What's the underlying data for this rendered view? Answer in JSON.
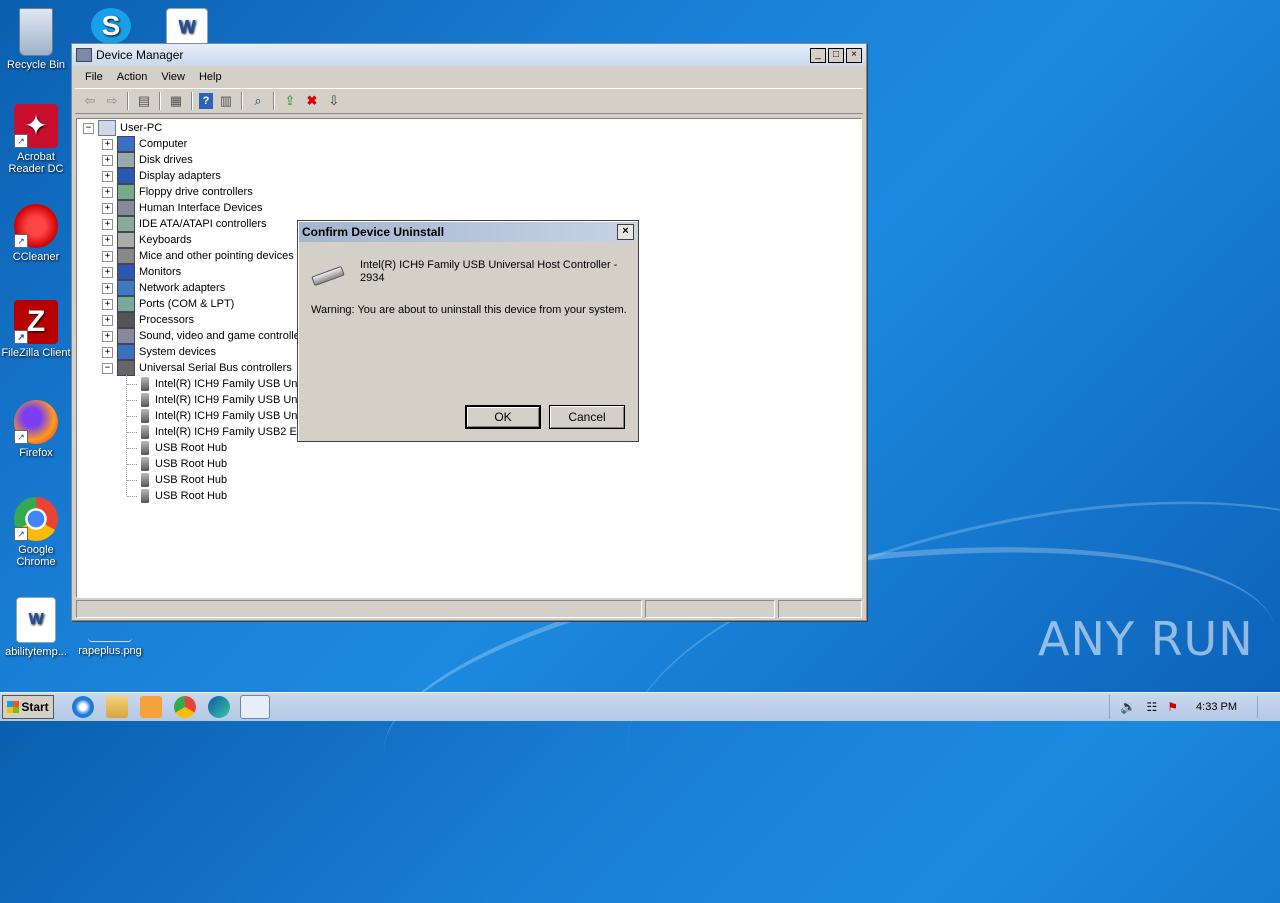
{
  "desktop": {
    "icons": [
      {
        "label": "Recycle Bin"
      },
      {
        "label": "Acrobat Reader DC"
      },
      {
        "label": "CCleaner"
      },
      {
        "label": "FileZilla Client"
      },
      {
        "label": "Firefox"
      },
      {
        "label": "Google Chrome"
      },
      {
        "label": "abilitytemp..."
      },
      {
        "label": "rapeplus.png"
      }
    ]
  },
  "window": {
    "title": "Device Manager",
    "controls": [
      "_",
      "□",
      "×"
    ],
    "menu": [
      "File",
      "Action",
      "View",
      "Help"
    ],
    "tree": {
      "root": "User-PC",
      "categories": [
        "Computer",
        "Disk drives",
        "Display adapters",
        "Floppy drive controllers",
        "Human Interface Devices",
        "IDE ATA/ATAPI controllers",
        "Keyboards",
        "Mice and other pointing devices",
        "Monitors",
        "Network adapters",
        "Ports (COM & LPT)",
        "Processors",
        "Sound, video and game controllers",
        "System devices",
        "Universal Serial Bus controllers"
      ],
      "usb_children": [
        "Intel(R) ICH9 Family USB Universal Host Controller - 2934",
        "Intel(R) ICH9 Family USB Universal Host Controller - 2935",
        "Intel(R) ICH9 Family USB Universal Host Controller - 2936",
        "Intel(R) ICH9 Family USB2 Enhanced Host Controller - 293A",
        "USB Root Hub",
        "USB Root Hub",
        "USB Root Hub",
        "USB Root Hub"
      ]
    }
  },
  "dialog": {
    "title": "Confirm Device Uninstall",
    "close": "×",
    "device_name": "Intel(R) ICH9 Family USB Universal Host Controller - 2934",
    "warning": "Warning: You are about to uninstall this device from your system.",
    "ok_label": "OK",
    "cancel_label": "Cancel"
  },
  "taskbar": {
    "start_label": "Start",
    "clock": "4:33 PM"
  },
  "watermark": "ANY RUN"
}
